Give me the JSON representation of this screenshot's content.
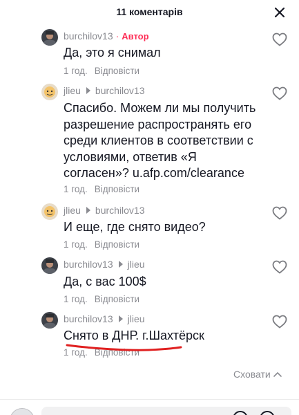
{
  "header": {
    "title": "11 коментарів"
  },
  "comments": [
    {
      "author": "burchilov13",
      "author_badge": "Автор",
      "reply_to": "",
      "text": "Да, это я снимал",
      "time": "1 год.",
      "reply_label": "Відповісти",
      "avatar": "avatar-man"
    },
    {
      "author": "jlieu",
      "reply_to": "burchilov13",
      "text": "Спасибо. Можем ли мы получить разрешение распространять его среди клиентов в соответствии с условиями, ответив «Я согласен»? u.afp.com/clearance",
      "time": "1 год.",
      "reply_label": "Відповісти",
      "avatar": "avatar-cartoon"
    },
    {
      "author": "jlieu",
      "reply_to": "burchilov13",
      "text": "И еще, где снято видео?",
      "time": "1 год.",
      "reply_label": "Відповісти",
      "avatar": "avatar-cartoon"
    },
    {
      "author": "burchilov13",
      "reply_to": "jlieu",
      "text": "Да, с вас 100$",
      "time": "1 год.",
      "reply_label": "Відповісти",
      "avatar": "avatar-man"
    },
    {
      "author": "burchilov13",
      "reply_to": "jlieu",
      "text": "Снято в ДНР. г.Шахтёрск",
      "time": "1 год.",
      "reply_label": "Відповісти",
      "avatar": "avatar-man"
    }
  ],
  "hide_replies": {
    "label": "Сховати"
  },
  "colors": {
    "accent": "#fe2c55",
    "annotation_underline": "#e02020",
    "secondary_text": "#8a8b91"
  },
  "icons": {
    "close": "close-icon",
    "like": "heart-outline-icon",
    "hide": "chevron-up-icon"
  }
}
